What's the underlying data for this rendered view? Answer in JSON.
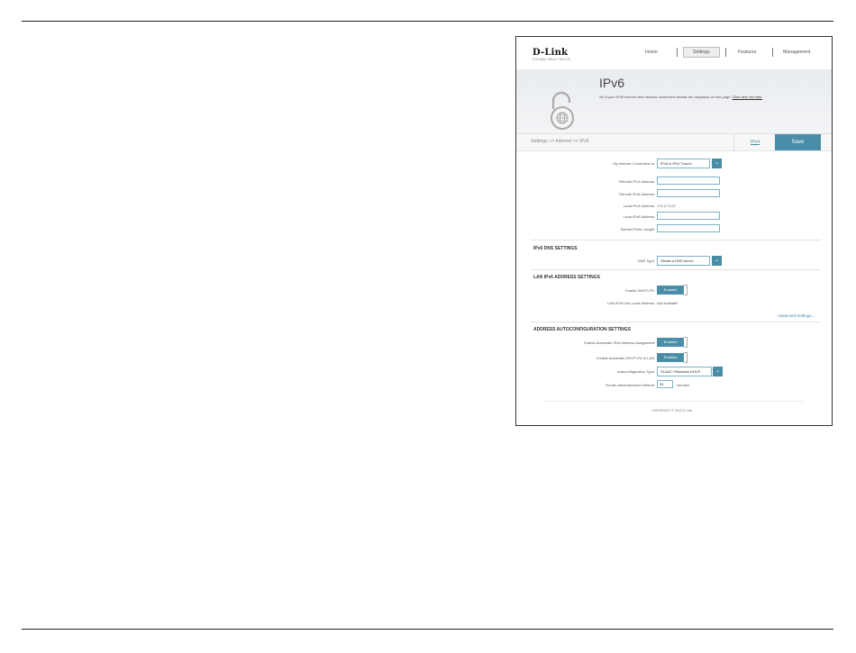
{
  "app": {
    "logo": "D-Link",
    "logo_sub": "DIR-868L   HW:A1   FW:1.00",
    "nav": [
      "Home",
      "Settings",
      "Features",
      "Management"
    ],
    "active_nav": "Settings"
  },
  "banner": {
    "title": "IPv6",
    "description": "All of your IPv6 Internet and network connection details are displayed on this page.",
    "help_link": "Click here for help."
  },
  "breadcrumb": "Settings >> Internet >> IPv6",
  "actions": {
    "ipv4_link": "IPv4",
    "save": "Save"
  },
  "connection": {
    "label": "My Internet Connection is:",
    "value": "IPv6 in IPv4 Tunnel",
    "fields": [
      {
        "label": "Remote IPv4 Address:",
        "value": ""
      },
      {
        "label": "Remote IPv6 Address:",
        "value": ""
      },
      {
        "label": "Local IPv4 Address:",
        "value": "172.17.5.47"
      },
      {
        "label": "Local IPv6 Address:",
        "value": ""
      },
      {
        "label": "Subnet Prefix Length:",
        "value": ""
      }
    ]
  },
  "dns": {
    "title": "IPv6 DNS SETTINGS",
    "type_label": "DNS Type:",
    "type_value": "Obtain a DNS server"
  },
  "lan": {
    "title": "LAN IPv6 ADDRESS SETTINGS",
    "dhcp_pd_label": "Enable DHCP-PD:",
    "dhcp_pd_value": "Enabled",
    "link_local_label": "LAN IPv6 Link-Local Address:",
    "link_local_value": "Not Available",
    "advanced": "Advanced Settings..."
  },
  "autoconf": {
    "title": "ADDRESS AUTOCONFIGURATION SETTINGS",
    "auto_assign_label": "Enable Automatic IPv6 Address Assignment:",
    "auto_assign_value": "Enabled",
    "auto_pd_label": "Enable Automatic DHCP-PD in LAN:",
    "auto_pd_value": "Enabled",
    "type_label": "Autoconfiguration Type:",
    "type_value": "SLAAC+Stateless DHCP",
    "lifetime_label": "Router Advertisement Lifetime:",
    "lifetime_value": "30",
    "lifetime_unit": "minutes"
  },
  "footer": "COPYRIGHT © 2013 D-Link",
  "colors": {
    "accent": "#4a8da6",
    "banner": "#eceef0"
  },
  "icons": {
    "banner_icon": "padlock-globe-icon",
    "dropdown": "chevron-down-icon"
  }
}
